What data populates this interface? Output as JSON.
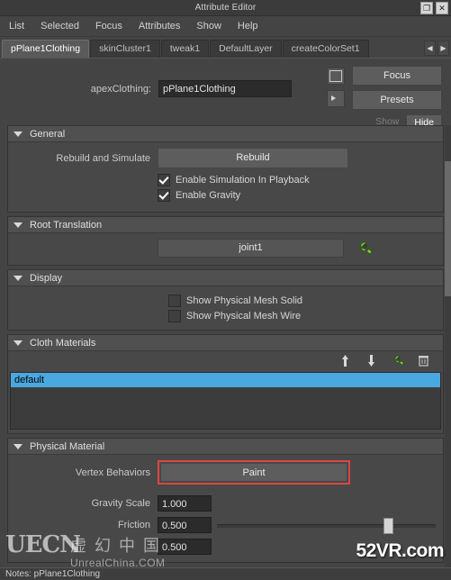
{
  "window": {
    "title": "Attribute Editor",
    "buttons": {
      "restore": "❐",
      "close": "✕"
    }
  },
  "menubar": {
    "items": [
      "List",
      "Selected",
      "Focus",
      "Attributes",
      "Show",
      "Help"
    ]
  },
  "tabs": {
    "items": [
      {
        "label": "pPlane1Clothing",
        "active": true
      },
      {
        "label": "skinCluster1",
        "active": false
      },
      {
        "label": "tweak1",
        "active": false
      },
      {
        "label": "DefaultLayer",
        "active": false
      },
      {
        "label": "createColorSet1",
        "active": false
      }
    ],
    "prev_arrow": "◀",
    "next_arrow": "▶"
  },
  "top": {
    "field_label": "apexClothing:",
    "field_value": "pPlane1Clothing",
    "focus_button": "Focus",
    "presets_button": "Presets",
    "show_button": "Show",
    "hide_button": "Hide"
  },
  "sections": {
    "general": {
      "title": "General",
      "rebuild_label": "Rebuild and Simulate",
      "rebuild_button": "Rebuild",
      "check_playback": "Enable Simulation In Playback",
      "check_gravity": "Enable Gravity"
    },
    "root_translation": {
      "title": "Root Translation",
      "value": "joint1"
    },
    "display": {
      "title": "Display",
      "check_solid": "Show Physical Mesh Solid",
      "check_wire": "Show Physical Mesh Wire"
    },
    "cloth_materials": {
      "title": "Cloth Materials",
      "list_items": [
        "default"
      ]
    },
    "physical_material": {
      "title": "Physical Material",
      "vertex_behaviors_label": "Vertex Behaviors",
      "paint_button": "Paint",
      "gravity_scale_label": "Gravity Scale",
      "gravity_scale_value": "1.000",
      "friction_label": "Friction",
      "friction_value": "0.500",
      "third_value": "0.500"
    }
  },
  "watermarks": {
    "uecn": "UECN",
    "cn_text": "虚 幻 中 国",
    "url": "UnrealChina.COM",
    "vr": "52VR.com"
  },
  "statusbar": {
    "text": "Notes: pPlane1Clothing"
  }
}
